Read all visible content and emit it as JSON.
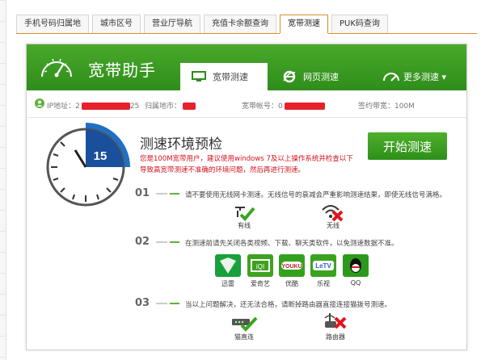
{
  "tabs": [
    {
      "label": "手机号码归属地"
    },
    {
      "label": "城市区号"
    },
    {
      "label": "营业厅导航"
    },
    {
      "label": "充值卡余额查询"
    },
    {
      "label": "宽带测速"
    },
    {
      "label": "PUK码查询"
    }
  ],
  "header": {
    "brand": "宽带助手",
    "nav": [
      {
        "label": "宽带测速"
      },
      {
        "label": "网页测速"
      },
      {
        "label": "更多测速 ▾"
      }
    ]
  },
  "info": {
    "ip_label": "IP地址：2",
    "ip_tail": "25",
    "location_label": "归属地市：",
    "account_label": "宽带帐号：0",
    "bandwidth": "签约带宽：100M"
  },
  "main": {
    "clock_number": "15",
    "title": "测速环境预检",
    "warning": "您是100M宽带用户，建议使用windows 7及以上操作系统并检查以下导致高宽带测速不准确的环境问题，然后再进行测速。",
    "start_label": "开始测速"
  },
  "steps": [
    {
      "num": "01",
      "text": "请不要使用无线网卡测速。无线信号的衰减会严重影响测速结果，即使无线信号满格。"
    },
    {
      "num": "02",
      "text": "在测速前请先关闭各类视频、下载、聊天类软件，以免测速数据不准。"
    },
    {
      "num": "03",
      "text": "当以上问题解决，还无法合格，请断掉路由器直接连接猫拨号测速。"
    }
  ],
  "conn": {
    "wired": "有线",
    "wireless": "无线"
  },
  "apps": [
    {
      "label": "迅雷",
      "color": "#18a03a"
    },
    {
      "label": "爱奇艺",
      "color": "#3ea21f"
    },
    {
      "label": "优酷",
      "color": "#34a11e"
    },
    {
      "label": "乐视",
      "color": "#3aa31e"
    },
    {
      "label": "QQ",
      "color": "#2b9a1c"
    }
  ],
  "router": {
    "modem": "猫直连",
    "router": "路由器"
  }
}
